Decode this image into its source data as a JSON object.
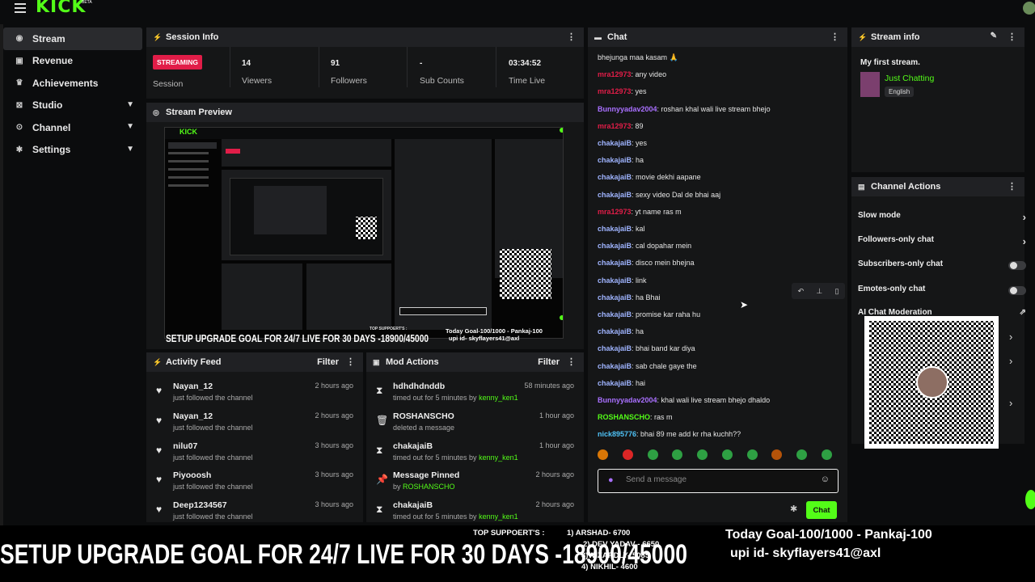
{
  "app": {
    "logo": "KICK",
    "logo_beta": "BETA"
  },
  "sidebar": {
    "items": [
      {
        "label": "Stream",
        "icon": "broadcast-icon"
      },
      {
        "label": "Revenue",
        "icon": "money-icon"
      },
      {
        "label": "Achievements",
        "icon": "trophy-icon"
      },
      {
        "label": "Studio",
        "icon": "studio-icon"
      },
      {
        "label": "Channel",
        "icon": "channel-icon"
      },
      {
        "label": "Settings",
        "icon": "gear-icon"
      }
    ]
  },
  "session": {
    "title": "Session Info",
    "badge": "STREAMING",
    "badge_label": "Session",
    "stats": [
      {
        "value": "14",
        "label": "Viewers"
      },
      {
        "value": "91",
        "label": "Followers"
      },
      {
        "value": "-",
        "label": "Sub Counts"
      },
      {
        "value": "03:34:52",
        "label": "Time Live"
      }
    ]
  },
  "preview": {
    "title": "Stream Preview",
    "goal_text": "SETUP UPGRADE GOAL FOR 24/7 LIVE  FOR 30 DAYS -18900/45000",
    "supporters_title": "TOP SUPPOERT'S :",
    "mini_goal": "Today Goal-100/1000 - Pankaj-100",
    "mini_upi": "upi id- skyflayers41@axl"
  },
  "activity": {
    "title": "Activity Feed",
    "filter": "Filter",
    "items": [
      {
        "name": "Nayan_12",
        "sub": "just followed the channel",
        "time": "2 hours ago"
      },
      {
        "name": "Nayan_12",
        "sub": "just followed the channel",
        "time": "2 hours ago"
      },
      {
        "name": "nilu07",
        "sub": "just followed the channel",
        "time": "3 hours ago"
      },
      {
        "name": "Piyooosh",
        "sub": "just followed the channel",
        "time": "3 hours ago"
      },
      {
        "name": "Deep1234567",
        "sub": "just followed the channel",
        "time": "3 hours ago"
      }
    ]
  },
  "mod": {
    "title": "Mod Actions",
    "filter": "Filter",
    "items": [
      {
        "name": "hdhdhdnddb",
        "sub": "timed out for 5 minutes by ",
        "by": "kenny_ken1",
        "time": "58 minutes ago",
        "icon": "hourglass-icon"
      },
      {
        "name": "ROSHANSCHO",
        "sub": "deleted a message",
        "by": "",
        "time": "1 hour ago",
        "icon": "trash-icon"
      },
      {
        "name": "chakajaiB",
        "sub": "timed out for 5 minutes by ",
        "by": "kenny_ken1",
        "time": "1 hour ago",
        "icon": "hourglass-icon"
      },
      {
        "name": "Message Pinned",
        "sub": "by ",
        "by": "ROSHANSCHO",
        "time": "2 hours ago",
        "icon": "pin-icon"
      },
      {
        "name": "chakajaiB",
        "sub": "timed out for 5 minutes by ",
        "by": "kenny_ken1",
        "time": "2 hours ago",
        "icon": "hourglass-icon"
      }
    ]
  },
  "chat": {
    "title": "Chat",
    "messages": [
      {
        "user": "",
        "text": "bhejunga maa kasam 🙏",
        "color": "#e6e6e6"
      },
      {
        "user": "mra12973",
        "text": ": any video",
        "color": "#e11d48"
      },
      {
        "user": "mra12973",
        "text": ": yes",
        "color": "#e11d48"
      },
      {
        "user": "Bunnyyadav2004",
        "text": ": roshan khal wali live stream bhejo",
        "color": "#a970ff"
      },
      {
        "user": "mra12973",
        "text": ": 89",
        "color": "#e11d48"
      },
      {
        "user": "chakajaiB",
        "text": ": yes",
        "color": "#9fb4ff"
      },
      {
        "user": "chakajaiB",
        "text": ": ha",
        "color": "#9fb4ff"
      },
      {
        "user": "chakajaiB",
        "text": ": movie dekhi aapane",
        "color": "#9fb4ff"
      },
      {
        "user": "chakajaiB",
        "text": ": sexy video Dal de bhai aaj",
        "color": "#9fb4ff"
      },
      {
        "user": "mra12973",
        "text": ": yt name ras m",
        "color": "#e11d48"
      },
      {
        "user": "chakajaiB",
        "text": ": kal",
        "color": "#9fb4ff"
      },
      {
        "user": "chakajaiB",
        "text": ": cal dopahar mein",
        "color": "#9fb4ff"
      },
      {
        "user": "chakajaiB",
        "text": ": disco mein bhejna",
        "color": "#9fb4ff"
      },
      {
        "user": "chakajaiB",
        "text": ": link",
        "color": "#9fb4ff"
      },
      {
        "user": "chakajaiB",
        "text": ": ha Bhai",
        "color": "#9fb4ff"
      },
      {
        "user": "chakajaiB",
        "text": ": promise kar raha hu",
        "color": "#9fb4ff"
      },
      {
        "user": "chakajaiB",
        "text": ": ha",
        "color": "#9fb4ff"
      },
      {
        "user": "chakajaiB",
        "text": ": bhai band kar diya",
        "color": "#9fb4ff"
      },
      {
        "user": "chakajaiB",
        "text": ": sab chale gaye the",
        "color": "#9fb4ff"
      },
      {
        "user": "chakajaiB",
        "text": ": hai",
        "color": "#9fb4ff"
      },
      {
        "user": "Bunnyyadav2004",
        "text": ": khal wali live stream bhejo dhaldo",
        "color": "#a970ff"
      },
      {
        "user": "ROSHANSCHO",
        "text": ": ras m",
        "color": "#53fc18"
      },
      {
        "user": "nick895776",
        "text": ": bhai 89 me add kr rha kuchh??",
        "color": "#4fc3f7"
      }
    ],
    "input_placeholder": "Send a message",
    "send_label": "Chat"
  },
  "stream_info": {
    "title": "Stream info",
    "stream_title": "My first stream.",
    "category": "Just Chatting",
    "language": "English"
  },
  "actions": {
    "title": "Channel Actions",
    "items": [
      {
        "label": "Slow mode",
        "control": "chevron"
      },
      {
        "label": "Followers-only chat",
        "control": "chevron"
      },
      {
        "label": "Subscribers-only chat",
        "control": "toggle"
      },
      {
        "label": "Emotes-only chat",
        "control": "toggle"
      },
      {
        "label": "AI Chat Moderation",
        "control": "external"
      }
    ]
  },
  "overlay": {
    "goal_big": "SETUP UPGRADE GOAL FOR 24/7 LIVE  FOR 30 DAYS -18900/45000",
    "supporters_title": "TOP SUPPOERT'S :",
    "supporters": [
      "1) ARSHAD- 6700",
      "2) DEV YADAV - 6650",
      "3)WIZARDLY- 5085",
      "4) NIKHIL- 4600"
    ],
    "today_goal": "Today Goal-100/1000 - Pankaj-100",
    "upi": "upi id- skyflayers41@axl"
  },
  "colors": {
    "accent": "#53fc18",
    "live": "#e11d48"
  }
}
